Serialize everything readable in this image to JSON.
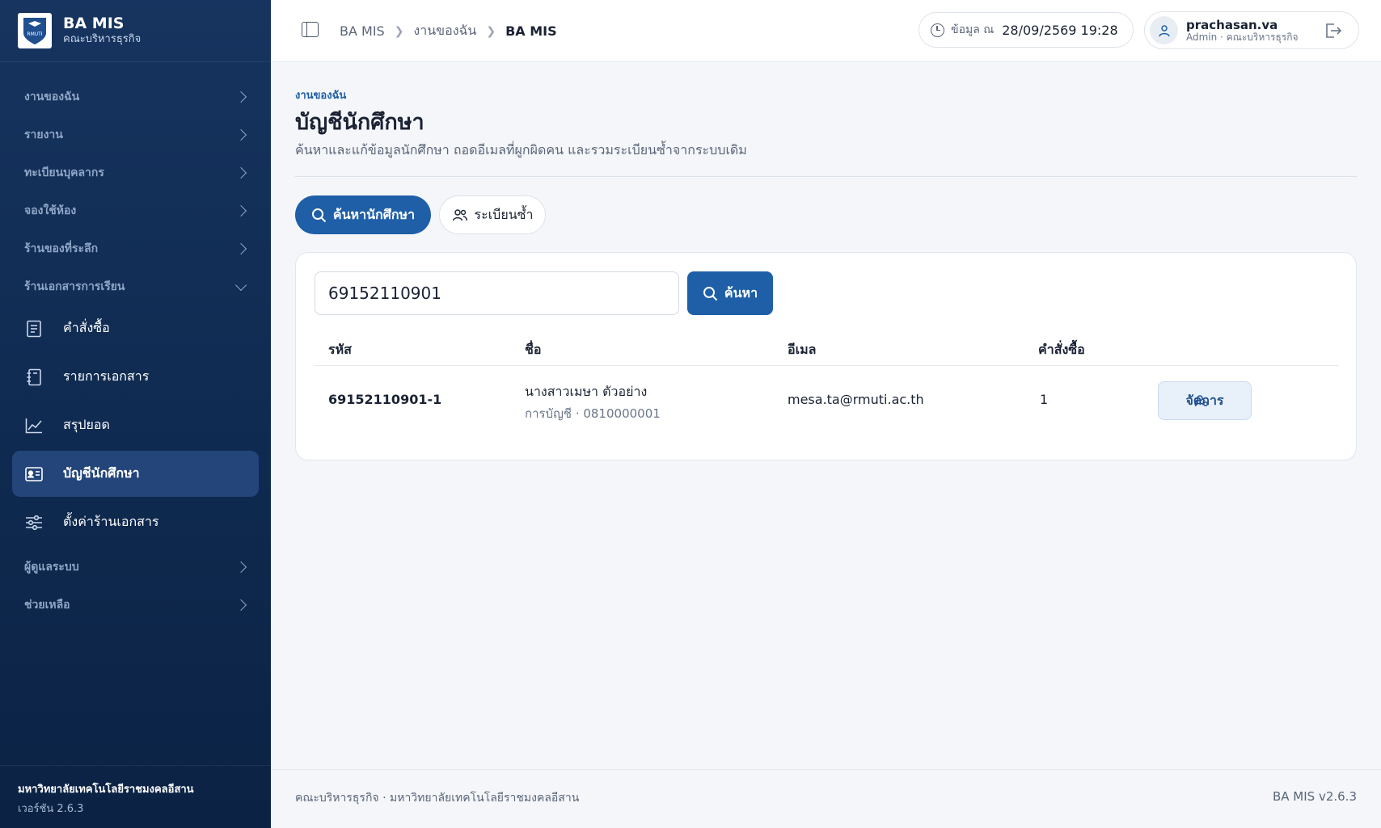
{
  "brand": {
    "title": "BA MIS",
    "subtitle": "คณะบริหารธุรกิจ",
    "logo_text": "RMUTI"
  },
  "sidebar": {
    "groups_top": [
      {
        "label": "งานของฉัน"
      },
      {
        "label": "รายงาน"
      },
      {
        "label": "ทะเบียนบุคลากร"
      },
      {
        "label": "จองใช้ห้อง"
      },
      {
        "label": "ร้านของที่ระลึก"
      }
    ],
    "open_group": {
      "label": "ร้านเอกสารการเรียน"
    },
    "items": [
      {
        "label": "คำสั่งซื้อ",
        "icon": "receipt-icon"
      },
      {
        "label": "รายการเอกสาร",
        "icon": "book-icon"
      },
      {
        "label": "สรุปยอด",
        "icon": "chart-line-icon"
      },
      {
        "label": "บัญชีนักศึกษา",
        "icon": "id-card-icon"
      },
      {
        "label": "ตั้งค่าร้านเอกสาร",
        "icon": "sliders-icon"
      }
    ],
    "groups_bottom": [
      {
        "label": "ผู้ดูแลระบบ"
      },
      {
        "label": "ช่วยเหลือ"
      }
    ],
    "footer": {
      "university": "มหาวิทยาลัยเทคโนโลยีราชมงคลอีสาน",
      "version": "เวอร์ชัน 2.6.3"
    }
  },
  "topbar": {
    "breadcrumb": [
      "BA MIS",
      "งานของฉัน",
      "BA MIS"
    ],
    "date_label": "ข้อมูล ณ",
    "date_value": "28/09/2569 19:28",
    "user_name": "prachasan.va",
    "user_role": "Admin · คณะบริหารธุรกิจ"
  },
  "page": {
    "eyebrow": "งานของฉัน",
    "title": "บัญชีนักศึกษา",
    "description": "ค้นหาและแก้ข้อมูลนักศึกษา ถอดอีเมลที่ผูกผิดคน และรวมระเบียนซ้ำจากระบบเดิม",
    "tabs": [
      {
        "label": "ค้นหานักศึกษา",
        "icon": "search-icon",
        "active": true
      },
      {
        "label": "ระเบียนซ้ำ",
        "icon": "users-icon",
        "active": false
      }
    ]
  },
  "search": {
    "value": "69152110901",
    "button": "ค้นหา"
  },
  "table": {
    "columns": [
      "รหัส",
      "ชื่อ",
      "อีเมล",
      "คำสั่งซื้อ"
    ],
    "rows": [
      {
        "code": "69152110901-1",
        "name": "นางสาวเมษา ตัวอย่าง",
        "account": "การบัญชี · 0810000001",
        "email": "mesa.ta@rmuti.ac.th",
        "orders": "1",
        "action": "จัดการ"
      }
    ]
  },
  "footer": {
    "left": "คณะบริหารธุรกิจ · มหาวิทยาลัยเทคโนโลยีราชมงคลอีสาน",
    "right": "BA MIS v2.6.3"
  },
  "colors": {
    "sidebar": "#16345f",
    "accent": "#1f5fa8",
    "active_item": "#23457a"
  }
}
